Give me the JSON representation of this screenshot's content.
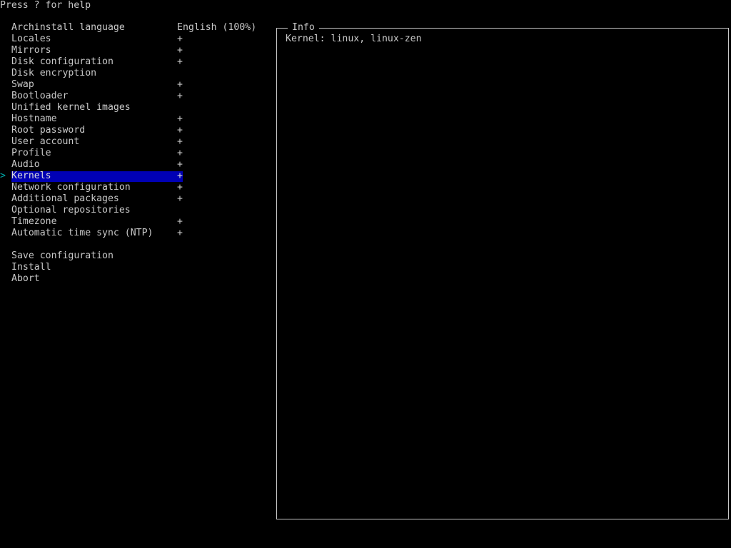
{
  "help_text": "Press ? for help",
  "menu": {
    "items": [
      {
        "label": "Archinstall language",
        "value": "English (100%)",
        "selected": false
      },
      {
        "label": "Locales",
        "value": "+",
        "selected": false
      },
      {
        "label": "Mirrors",
        "value": "+",
        "selected": false
      },
      {
        "label": "Disk configuration",
        "value": "+",
        "selected": false
      },
      {
        "label": "Disk encryption",
        "value": "",
        "selected": false
      },
      {
        "label": "Swap",
        "value": "+",
        "selected": false
      },
      {
        "label": "Bootloader",
        "value": "+",
        "selected": false
      },
      {
        "label": "Unified kernel images",
        "value": "",
        "selected": false
      },
      {
        "label": "Hostname",
        "value": "+",
        "selected": false
      },
      {
        "label": "Root password",
        "value": "+",
        "selected": false
      },
      {
        "label": "User account",
        "value": "+",
        "selected": false
      },
      {
        "label": "Profile",
        "value": "+",
        "selected": false
      },
      {
        "label": "Audio",
        "value": "+",
        "selected": false
      },
      {
        "label": "Kernels",
        "value": "+",
        "selected": true
      },
      {
        "label": "Network configuration",
        "value": "+",
        "selected": false
      },
      {
        "label": "Additional packages",
        "value": "+",
        "selected": false
      },
      {
        "label": "Optional repositories",
        "value": "",
        "selected": false
      },
      {
        "label": "Timezone",
        "value": "+",
        "selected": false
      },
      {
        "label": "Automatic time sync (NTP)",
        "value": "+",
        "selected": false
      }
    ],
    "actions": [
      {
        "label": "Save configuration"
      },
      {
        "label": "Install"
      },
      {
        "label": "Abort"
      }
    ],
    "cursor_glyph": ">"
  },
  "info": {
    "title": "Info",
    "content": "Kernel: linux, linux-zen"
  },
  "colors": {
    "background": "#000000",
    "text": "#c8c8c8",
    "highlight": "#0000b4",
    "cursor": "#00a8a8"
  }
}
